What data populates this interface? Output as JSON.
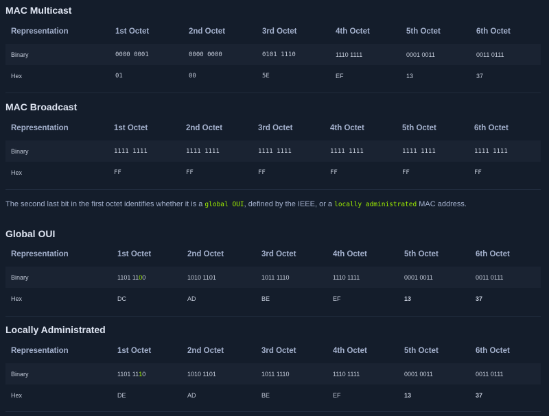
{
  "sections": {
    "multicast": {
      "title": "MAC Multicast",
      "headers": [
        "Representation",
        "1st Octet",
        "2nd Octet",
        "3rd Octet",
        "4th Octet",
        "5th Octet",
        "6th Octet"
      ],
      "binary": [
        "Binary",
        "0000 0001",
        "0000 0000",
        "0101 1110",
        "1110 1111",
        "0001 0011",
        "0011 0111"
      ],
      "hex": [
        "Hex",
        "01",
        "00",
        "5E",
        "EF",
        "13",
        "37"
      ]
    },
    "broadcast": {
      "title": "MAC Broadcast",
      "headers": [
        "Representation",
        "1st Octet",
        "2nd Octet",
        "3rd Octet",
        "4th Octet",
        "5th Octet",
        "6th Octet"
      ],
      "binary": [
        "Binary",
        "1111 1111",
        "1111 1111",
        "1111 1111",
        "1111 1111",
        "1111 1111",
        "1111 1111"
      ],
      "hex": [
        "Hex",
        "FF",
        "FF",
        "FF",
        "FF",
        "FF",
        "FF"
      ]
    },
    "paragraph": {
      "part1": "The second last bit in the first octet identifies whether it is a ",
      "code1": "global OUI",
      "part2": ", defined by the IEEE, or a ",
      "code2": "locally administrated",
      "part3": " MAC address."
    },
    "global_oui": {
      "title": "Global OUI",
      "headers": [
        "Representation",
        "1st Octet",
        "2nd Octet",
        "3rd Octet",
        "4th Octet",
        "5th Octet",
        "6th Octet"
      ],
      "binary_label": "Binary",
      "binary_first_prefix": "1101 11",
      "binary_first_highlight": "0",
      "binary_first_suffix": "0",
      "binary": [
        "1010 1101",
        "1011 1110",
        "1110 1111",
        "0001 0011",
        "0011 0111"
      ],
      "hex": [
        "Hex",
        "DC",
        "AD",
        "BE",
        "EF",
        "13",
        "37"
      ]
    },
    "local": {
      "title": "Locally Administrated",
      "headers": [
        "Representation",
        "1st Octet",
        "2nd Octet",
        "3rd Octet",
        "4th Octet",
        "5th Octet",
        "6th Octet"
      ],
      "binary_label": "Binary",
      "binary_first_prefix": "1101 11",
      "binary_first_highlight": "1",
      "binary_first_suffix": "0",
      "binary": [
        "1010 1101",
        "1011 1110",
        "1110 1111",
        "0001 0011",
        "0011 0111"
      ],
      "hex": [
        "Hex",
        "DE",
        "AD",
        "BE",
        "EF",
        "13",
        "37"
      ]
    }
  },
  "colors": {
    "background": "#141d2b",
    "alt_row": "#1a2332",
    "accent_green": "#9fef00",
    "heading": "#dfe5f2",
    "text": "#a4b1cd"
  }
}
